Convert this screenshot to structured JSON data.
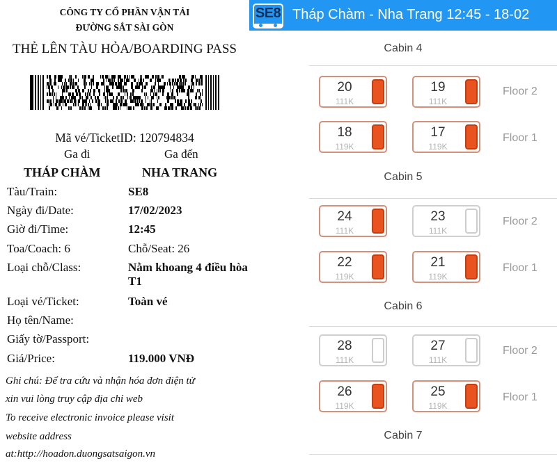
{
  "ticket": {
    "company_line1": "CÔNG TY CỔ PHẦN VẬN TẢI",
    "company_line2": "ĐƯỜNG SẮT SÀI GÒN",
    "title": "THẺ LÊN TÀU HỎA/BOARDING PASS",
    "ticket_id": "Mã vé/TicketID: 120794834",
    "from_label": "Ga đi",
    "to_label": "Ga đến",
    "from_station": "THÁP CHÀM",
    "to_station": "NHA TRANG",
    "train_label": "Tàu/Train:",
    "train_value": "SE8",
    "date_label": "Ngày đi/Date:",
    "date_value": "17/02/2023",
    "time_label": "Giờ đi/Time:",
    "time_value": "12:45",
    "coach_text": "Toa/Coach: 6",
    "seat_text": "Chỗ/Seat: 26",
    "class_label": "Loại chỗ/Class:",
    "class_value": "Nằm khoang 4 điều hòa T1",
    "ticket_type_label": "Loại vé/Ticket:",
    "ticket_type_value": "Toàn vé",
    "name_label": "Họ tên/Name:",
    "passport_label": "Giấy tờ/Passport:",
    "price_label": "Giá/Price:",
    "price_value": "119.000 VNĐ",
    "note_lines": [
      "Ghi chú: Để tra cứu và nhận hóa đơn điện tử",
      "xin vui lòng truy cập địa chỉ web",
      "To receive electronic invoice please visit",
      "website address",
      "at:http://hoadon.duongsatsaigon.vn"
    ]
  },
  "app": {
    "train_code": "SE8",
    "route_title": "Tháp Chàm - Nha Trang  12:45 - 18-02",
    "colors": {
      "bar": "#2196f3",
      "booked": "#e8531f",
      "booked_border": "#d4907a",
      "available_border": "#cfcfcf"
    },
    "cabins": [
      {
        "label": "Cabin 4",
        "rows": [
          {
            "floor": "Floor 2",
            "seats": [
              {
                "num": "20",
                "price": "111K",
                "booked": true
              },
              {
                "num": "19",
                "price": "111K",
                "booked": true
              }
            ]
          },
          {
            "floor": "Floor 1",
            "seats": [
              {
                "num": "18",
                "price": "119K",
                "booked": true
              },
              {
                "num": "17",
                "price": "119K",
                "booked": true
              }
            ]
          }
        ]
      },
      {
        "label": "Cabin 5",
        "rows": [
          {
            "floor": "Floor 2",
            "seats": [
              {
                "num": "24",
                "price": "111K",
                "booked": true
              },
              {
                "num": "23",
                "price": "111K",
                "booked": false
              }
            ]
          },
          {
            "floor": "Floor 1",
            "seats": [
              {
                "num": "22",
                "price": "119K",
                "booked": true
              },
              {
                "num": "21",
                "price": "119K",
                "booked": true
              }
            ]
          }
        ]
      },
      {
        "label": "Cabin 6",
        "rows": [
          {
            "floor": "Floor 2",
            "seats": [
              {
                "num": "28",
                "price": "111K",
                "booked": false
              },
              {
                "num": "27",
                "price": "111K",
                "booked": false
              }
            ]
          },
          {
            "floor": "Floor 1",
            "seats": [
              {
                "num": "26",
                "price": "119K",
                "booked": true
              },
              {
                "num": "25",
                "price": "119K",
                "booked": true
              }
            ]
          }
        ]
      },
      {
        "label": "Cabin 7",
        "rows": []
      }
    ]
  }
}
